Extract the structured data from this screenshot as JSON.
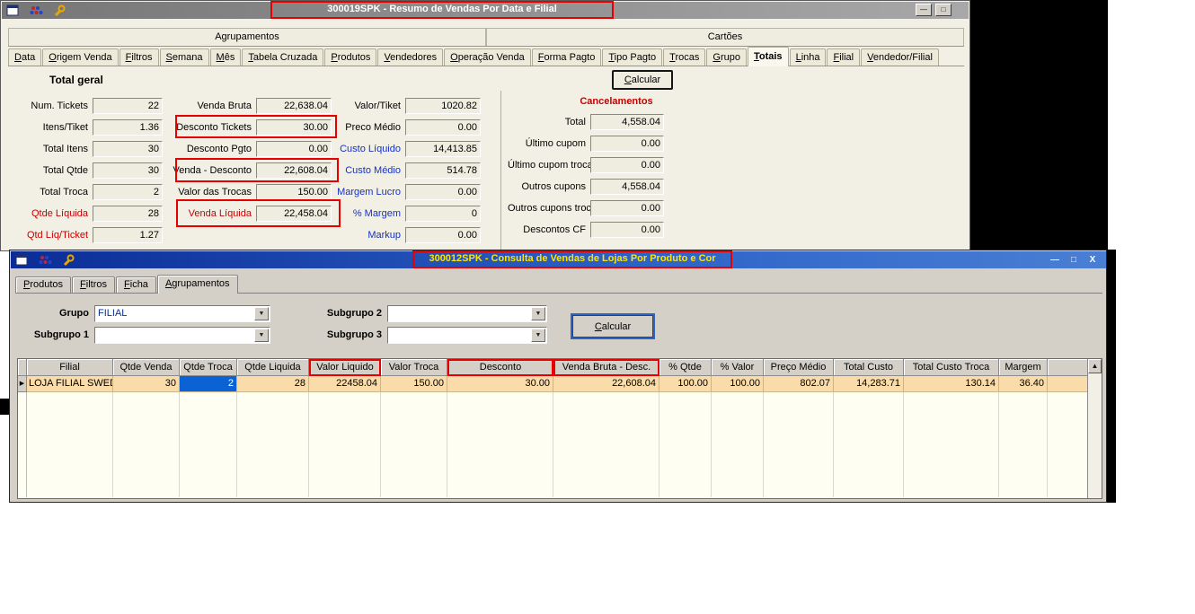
{
  "colors": {
    "annotation_red": "#e80000",
    "active_title_blue": "#0b2c96",
    "inactive_title_gray": "#8a8a8a",
    "selection_blue": "#0a62d4",
    "row_highlight_peach": "#f9dca9",
    "label_blue": "#1430c8",
    "label_red": "#c80000",
    "title_text_yellow": "#ffe400"
  },
  "icons": {
    "combo_arrow": "▼",
    "scroll_up": "▲",
    "row_marker": "▶"
  },
  "top_window": {
    "title": "300019SPK - Resumo de Vendas Por Data e Filial",
    "window_buttons": {
      "minimize": "—",
      "maximize": "□"
    },
    "group_tabs": [
      "Agrupamentos",
      "Cartões"
    ],
    "tabs": [
      "Data",
      "Origem Venda",
      "Filtros",
      "Semana",
      "Mês",
      "Tabela Cruzada",
      "Produtos",
      "Vendedores",
      "Operação Venda",
      "Forma Pagto",
      "Tipo Pagto",
      "Trocas",
      "Grupo",
      "Totais",
      "Linha",
      "Filial",
      "Vendedor/Filial"
    ],
    "selected_tab": "Totais",
    "section_heading": "Total geral",
    "calc_button_label": "Calcular",
    "col1": [
      {
        "label": "Num. Tickets",
        "value": "22"
      },
      {
        "label": "Itens/Tiket",
        "value": "1.36"
      },
      {
        "label": "Total Itens",
        "value": "30"
      },
      {
        "label": "Total Qtde",
        "value": "30"
      },
      {
        "label": "Total Troca",
        "value": "2"
      },
      {
        "label": "Qtde Líquida",
        "value": "28"
      },
      {
        "label": "Qtd Líq/Ticket",
        "value": "1.27"
      }
    ],
    "col2": [
      {
        "label": "Venda Bruta",
        "value": "22,638.04"
      },
      {
        "label": "Desconto Tickets",
        "value": "30.00"
      },
      {
        "label": "Desconto Pgto",
        "value": "0.00"
      },
      {
        "label": "Venda - Desconto",
        "value": "22,608.04"
      },
      {
        "label": "Valor das Trocas",
        "value": "150.00"
      },
      {
        "label": "Venda Líquida",
        "value": "22,458.04"
      }
    ],
    "col3": [
      {
        "label": "Valor/Tiket",
        "value": "1020.82"
      },
      {
        "label": "Preco Médio",
        "value": "0.00"
      },
      {
        "label": "Custo Líquido",
        "value": "14,413.85"
      },
      {
        "label": "Custo Médio",
        "value": "514.78"
      },
      {
        "label": "Margem Lucro",
        "value": "0.00"
      },
      {
        "label": "% Margem",
        "value": "0"
      },
      {
        "label": "Markup",
        "value": "0.00"
      }
    ],
    "cancel": {
      "heading": "Cancelamentos",
      "rows": [
        {
          "label": "Total",
          "value": "4,558.04"
        },
        {
          "label": "Último cupom",
          "value": "0.00"
        },
        {
          "label": "Último cupom troca",
          "value": "0.00"
        },
        {
          "label": "Outros cupons",
          "value": "4,558.04"
        },
        {
          "label": "Outros cupons troca",
          "value": "0.00"
        },
        {
          "label": "Descontos CF",
          "value": "0.00"
        }
      ]
    }
  },
  "bottom_window": {
    "title": "300012SPK - Consulta de Vendas de Lojas Por Produto e Cor",
    "window_buttons": {
      "minimize": "—",
      "maximize": "□",
      "close": "X"
    },
    "tabs": [
      "Produtos",
      "Filtros",
      "Ficha",
      "Agrupamentos"
    ],
    "selected_tab": "Agrupamentos",
    "form": {
      "grupo_label": "Grupo",
      "grupo_value": "FILIAL",
      "subgrupo1_label": "Subgrupo 1",
      "subgrupo1_value": "",
      "subgrupo2_label": "Subgrupo 2",
      "subgrupo2_value": "",
      "subgrupo3_label": "Subgrupo 3",
      "subgrupo3_value": "",
      "calc_button_label": "Calcular"
    },
    "grid": {
      "headers": [
        "Filial",
        "Qtde Venda",
        "Qtde Troca",
        "Qtde Liquida",
        "Valor Liquido",
        "Valor Troca",
        "Desconto",
        "Venda Bruta - Desc.",
        "% Qtde",
        "% Valor",
        "Preço Médio",
        "Total Custo",
        "Total Custo Troca",
        "Margem"
      ],
      "row": [
        "LOJA FILIAL SWEDA",
        "30",
        "2",
        "28",
        "22458.04",
        "150.00",
        "30.00",
        "22,608.04",
        "100.00",
        "100.00",
        "802.07",
        "14,283.71",
        "130.14",
        "36.40"
      ],
      "selected_cell_value": "2"
    }
  }
}
